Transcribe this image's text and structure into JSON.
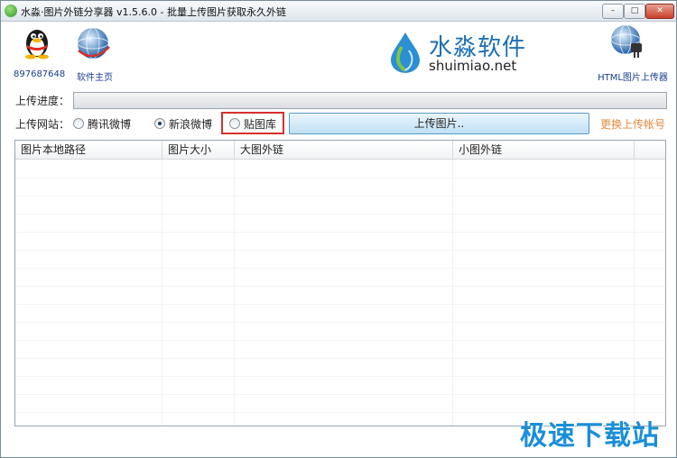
{
  "window": {
    "title": "水淼·图片外链分享器 v1.5.6.0 - 批量上传图片获取永久外链",
    "buttons": {
      "minimize": "–",
      "maximize": "□",
      "close": "✕"
    }
  },
  "toolbar": {
    "qq": {
      "icon": "qq-penguin-icon",
      "label": "897687648"
    },
    "homepage": {
      "icon": "globe-icon",
      "label": "软件主页"
    },
    "logo": {
      "cn": "水淼软件",
      "en": "shuimiao.net"
    },
    "html_uploader": {
      "icon": "globe-plug-icon",
      "label": "HTML图片上传器"
    }
  },
  "progress": {
    "label": "上传进度：",
    "value": 0
  },
  "site": {
    "label": "上传网站：",
    "options": [
      {
        "label": "腾讯微博",
        "selected": false
      },
      {
        "label": "新浪微博",
        "selected": true
      },
      {
        "label": "贴图库",
        "selected": false
      }
    ],
    "upload_button": "上传图片..",
    "change_account": "更换上传帐号"
  },
  "table": {
    "columns": [
      "图片本地路径",
      "图片大小",
      "大图外链",
      "小图外链"
    ],
    "rows": []
  },
  "watermark": "极速下载站",
  "colors": {
    "link_orange": "#e28a3e",
    "highlight_red": "#d6312d",
    "logo_blue": "#1b6fb5"
  }
}
